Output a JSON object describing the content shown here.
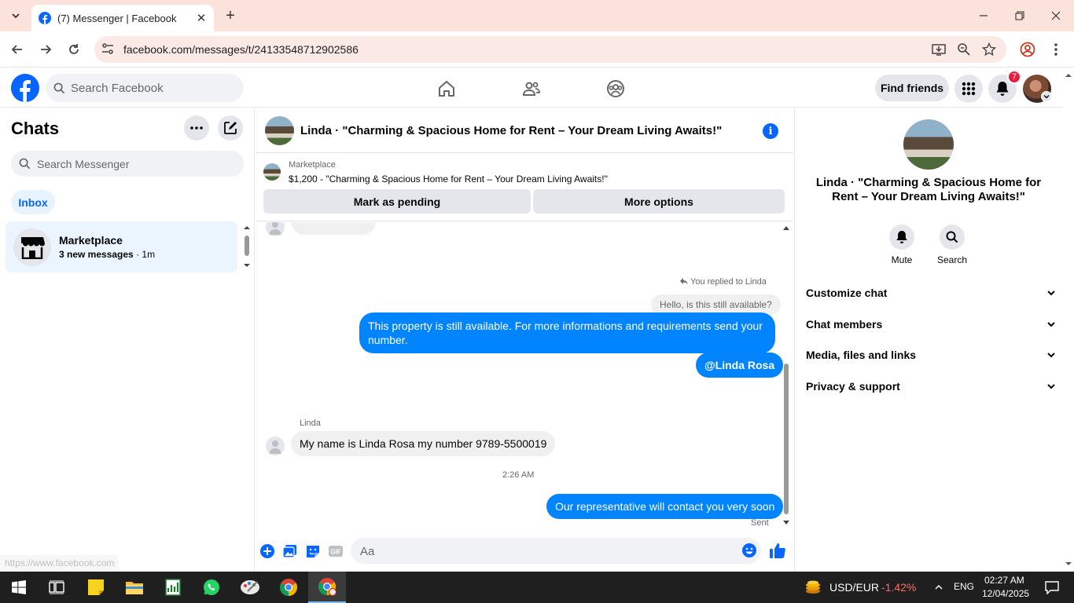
{
  "browser": {
    "tab_title": "(7) Messenger | Facebook",
    "url": "facebook.com/messages/t/24133548712902586",
    "status_url": "https://www.facebook.com"
  },
  "header": {
    "search_placeholder": "Search Facebook",
    "find_friends": "Find friends",
    "notification_count": "7"
  },
  "left": {
    "title": "Chats",
    "search_placeholder": "Search Messenger",
    "inbox_label": "Inbox",
    "conversation": {
      "name": "Marketplace",
      "new_messages": "3 new messages",
      "time": " · 1m"
    }
  },
  "chat": {
    "title": "Linda · \"Charming & Spacious Home for Rent – Your Dream Living Awaits!\"",
    "marketplace_label": "Marketplace",
    "listing": "$1,200 - \"Charming & Spacious Home for Rent – Your Dream Living Awaits!\"",
    "mark_pending": "Mark as pending",
    "more_options": "More options",
    "reply_note": "You replied to Linda",
    "reply_quote": "Hello, is this still available?",
    "msg1": "This property is still available. For more informations and requirements send your number.",
    "msg2": "@Linda Rosa",
    "sender": "Linda",
    "msg3": "My name is Linda Rosa my number 9789-5500019",
    "time": "2:26 AM",
    "msg4": "Our representative will contact you very soon",
    "sent": "Sent",
    "composer_placeholder": "Aa"
  },
  "right": {
    "title": "Linda · \"Charming & Spacious Home for Rent – Your Dream Living Awaits!\"",
    "mute": "Mute",
    "search": "Search",
    "rows": [
      "Customize chat",
      "Chat members",
      "Media, files and links",
      "Privacy & support"
    ]
  },
  "taskbar": {
    "ticker": "USD/EUR",
    "ticker_change": "-1.42%",
    "lang": "ENG",
    "clock_time": "02:27 AM",
    "clock_date": "12/04/2025"
  },
  "colors": {
    "fb_blue": "#0866ff",
    "bubble_blue": "#0084ff",
    "tab_strip": "#fbe3dc",
    "ticker_negative": "#ff6b6b"
  }
}
